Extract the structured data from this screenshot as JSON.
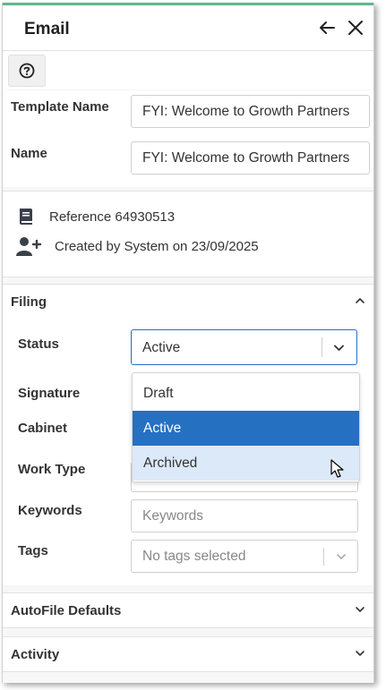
{
  "header": {
    "title": "Email"
  },
  "toolbar": {
    "help_icon": "question-circle-icon"
  },
  "fields": {
    "template_name_label": "Template Name",
    "template_name_value": "FYI: Welcome to Growth Partners",
    "name_label": "Name",
    "name_value": "FYI: Welcome to Growth Partners"
  },
  "info": {
    "reference": "Reference 64930513",
    "created": "Created by System on 23/09/2025"
  },
  "filing": {
    "title": "Filing",
    "status_label": "Status",
    "status_value": "Active",
    "signature_label": "Signature",
    "cabinet_label": "Cabinet",
    "work_type_label": "Work Type",
    "keywords_label": "Keywords",
    "keywords_placeholder": "Keywords",
    "tags_label": "Tags",
    "tags_placeholder": "No tags selected",
    "status_options": [
      "Draft",
      "Active",
      "Archived"
    ]
  },
  "sections": {
    "autofile": "AutoFile Defaults",
    "activity": "Activity"
  },
  "colors": {
    "accent": "#2670c2",
    "top_bar": "#5fb88a",
    "hover": "#dce9f8"
  }
}
